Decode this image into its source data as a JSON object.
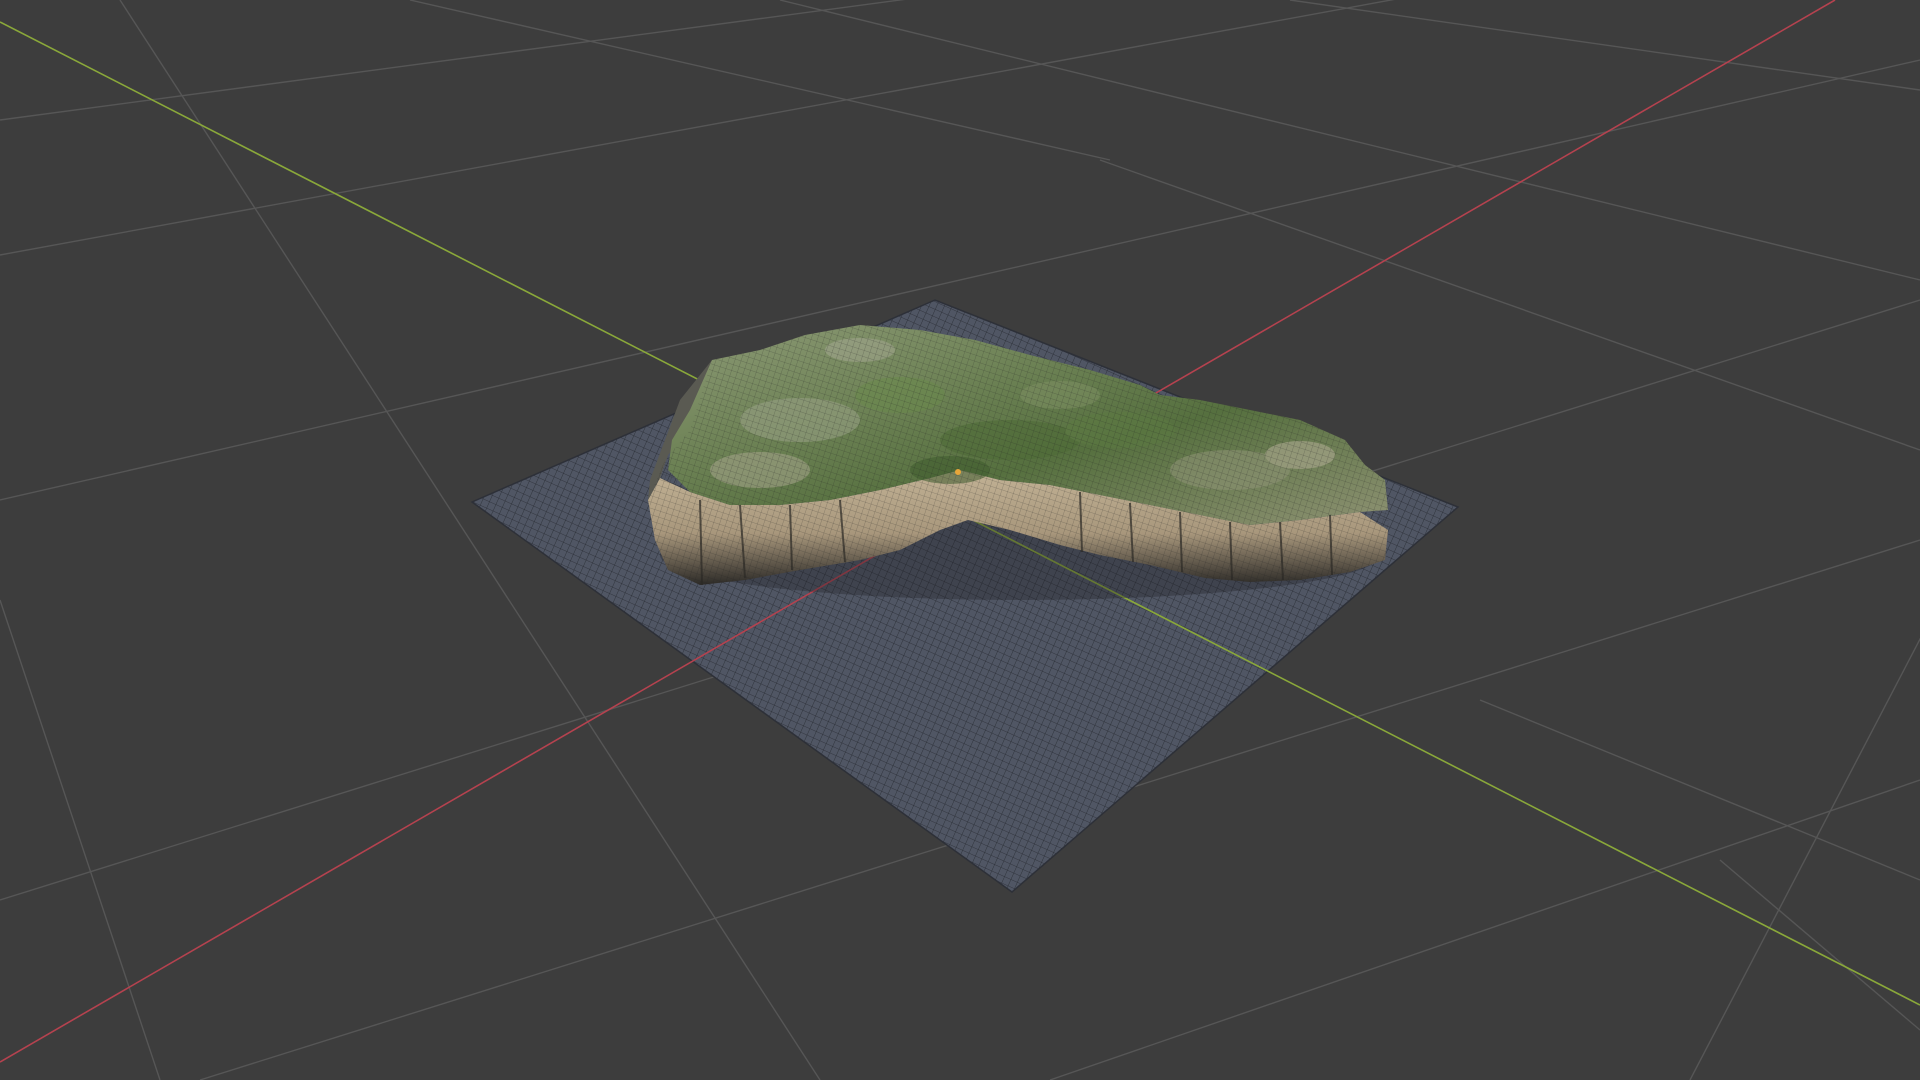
{
  "viewport": {
    "background_color": "#3d3d3d",
    "grid_color": "#555555",
    "x_axis_color": "#b5424f",
    "y_axis_color": "#8aa83a"
  },
  "objects": [
    {
      "name": "ground-plane",
      "type": "mesh",
      "wireframe": true,
      "color": "#525866"
    },
    {
      "name": "terrain-mesh",
      "type": "mesh",
      "wireframe": true,
      "colors": [
        "#7b8a63",
        "#5e7343",
        "#b8a78a",
        "#2a2a2a"
      ]
    }
  ]
}
